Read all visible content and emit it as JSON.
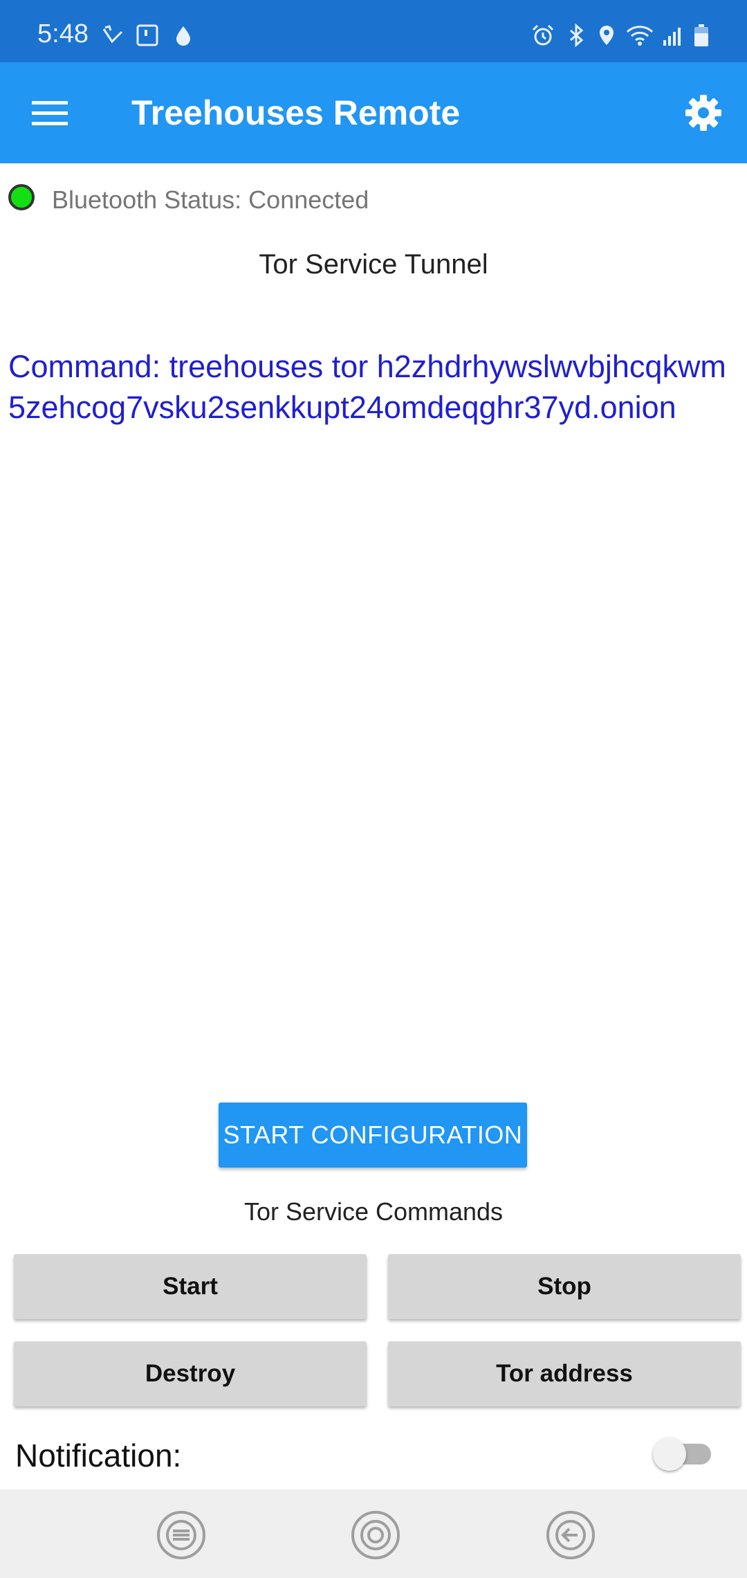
{
  "status_bar": {
    "time": "5:48",
    "left_icons": [
      "missed-call-icon",
      "sim-icon",
      "drop-icon"
    ],
    "right_icons": [
      "alarm-icon",
      "bluetooth-icon",
      "location-icon",
      "wifi-icon",
      "signal-icon",
      "battery-icon"
    ]
  },
  "app_bar": {
    "title": "Treehouses Remote",
    "menu_icon": "hamburger-menu-icon",
    "settings_icon": "gear-icon",
    "color": "#2196f3"
  },
  "bluetooth": {
    "status_text": "Bluetooth Status: Connected",
    "indicator_color": "#12e012"
  },
  "tor": {
    "section_title": "Tor Service Tunnel",
    "command_text": "Command:  treehouses tor h2zhdrhywslwvbjhcqkwm5zehcog7vsku2senkkupt24omdeqghr37yd.onion",
    "command_color": "#1f1fd0"
  },
  "config_button": {
    "label": "START CONFIGURATION"
  },
  "commands": {
    "title": "Tor Service Commands",
    "buttons": [
      "Start",
      "Stop",
      "Destroy",
      "Tor address"
    ]
  },
  "notification": {
    "label": "Notification:",
    "enabled": false
  },
  "nav_bar": {
    "icons": [
      "recents-icon",
      "home-icon",
      "back-icon"
    ]
  }
}
